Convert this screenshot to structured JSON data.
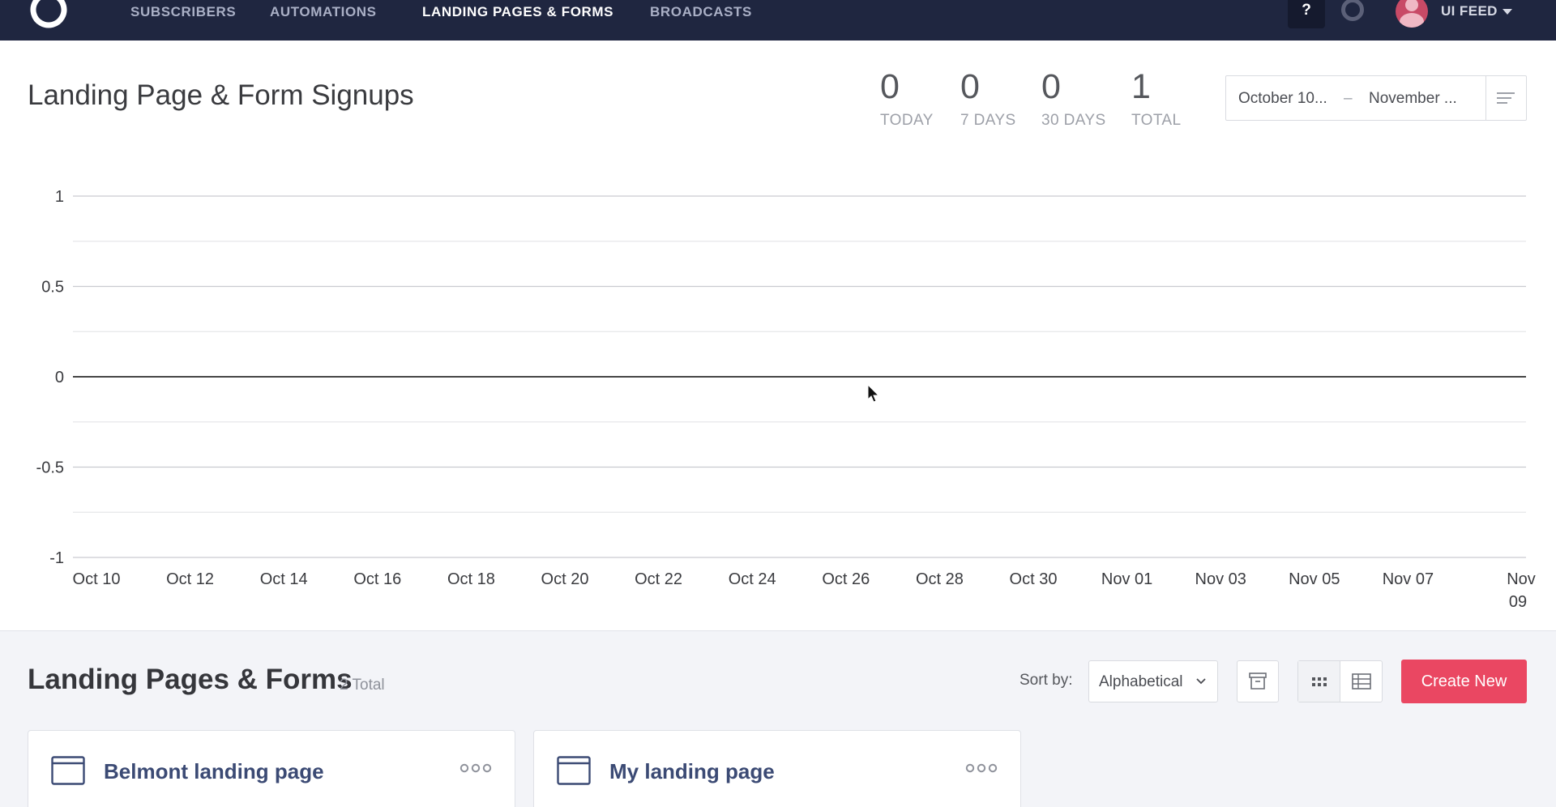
{
  "nav": {
    "items": [
      "SUBSCRIBERS",
      "AUTOMATIONS",
      "LANDING PAGES & FORMS",
      "BROADCASTS"
    ],
    "active_index": 2,
    "help_label": "?",
    "user_name": "UI FEED"
  },
  "header": {
    "title": "Landing Page & Form Signups",
    "stats": [
      {
        "value": "0",
        "label": "TODAY"
      },
      {
        "value": "0",
        "label": "7 DAYS"
      },
      {
        "value": "0",
        "label": "30 DAYS"
      },
      {
        "value": "1",
        "label": "TOTAL"
      }
    ],
    "date_range": {
      "start": "October 10...",
      "separator": "–",
      "end": "November ..."
    }
  },
  "chart_data": {
    "type": "line",
    "title": "",
    "xlabel": "",
    "ylabel": "",
    "ylim": [
      -1,
      1
    ],
    "y_ticks": [
      "1",
      "0.5",
      "0",
      "-0.5",
      "-1"
    ],
    "categories": [
      "Oct 10",
      "Oct 12",
      "Oct 14",
      "Oct 16",
      "Oct 18",
      "Oct 20",
      "Oct 22",
      "Oct 24",
      "Oct 26",
      "Oct 28",
      "Oct 30",
      "Nov 01",
      "Nov 03",
      "Nov 05",
      "Nov 07",
      "Nov 09"
    ],
    "series": [
      {
        "values": [
          0,
          0,
          0,
          0,
          0,
          0,
          0,
          0,
          0,
          0,
          0,
          0,
          0,
          0,
          0,
          0
        ]
      }
    ],
    "grid": true
  },
  "section": {
    "title": "Landing Pages & Forms",
    "count": "2 Total",
    "sort_label": "Sort by:",
    "sort_value": "Alphabetical",
    "create_label": "Create New"
  },
  "cards": [
    {
      "title": "Belmont landing page"
    },
    {
      "title": "My landing page"
    }
  ],
  "colors": {
    "nav_bg": "#1f2640",
    "accent": "#ea4762",
    "card_title": "#3b4a74",
    "lower_bg": "#f3f4f8"
  }
}
